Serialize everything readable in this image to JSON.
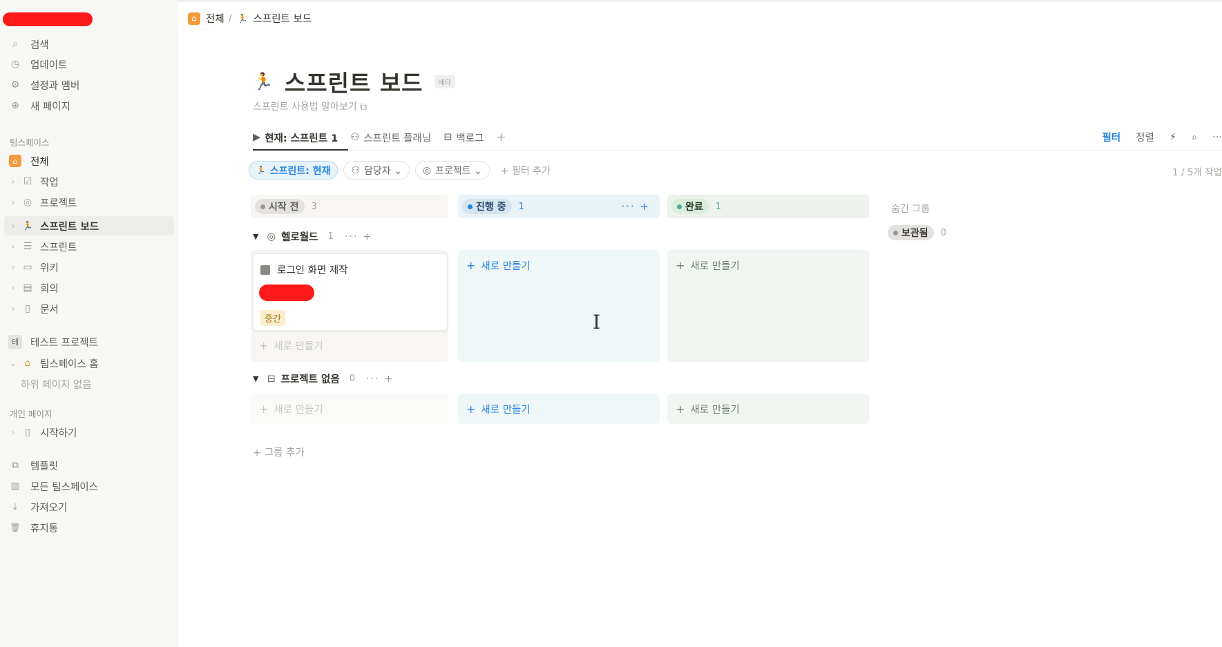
{
  "sidebar": {
    "top_items": [
      {
        "label": "검색",
        "icon": "search-icon",
        "glyph": "⌕"
      },
      {
        "label": "업데이트",
        "icon": "clock-icon",
        "glyph": "◷"
      },
      {
        "label": "설정과 멤버",
        "icon": "gear-icon",
        "glyph": "⚙"
      },
      {
        "label": "새 페이지",
        "icon": "plus-circle-icon",
        "glyph": "⊕"
      }
    ],
    "section_teamspace": "팀스페이스",
    "all_label": "전체",
    "tree_items": [
      {
        "label": "작업",
        "icon": "checkbox-icon",
        "glyph": "☑"
      },
      {
        "label": "프로젝트",
        "icon": "target-icon",
        "glyph": "◎"
      },
      {
        "label": "스프린트 보드",
        "icon": "runner-icon",
        "glyph": "🏃"
      },
      {
        "label": "스프린트",
        "icon": "database-icon",
        "glyph": "☰"
      },
      {
        "label": "위키",
        "icon": "book-icon",
        "glyph": "▭"
      },
      {
        "label": "회의",
        "icon": "calendar-icon",
        "glyph": "▤"
      },
      {
        "label": "문서",
        "icon": "document-icon",
        "glyph": "▯"
      }
    ],
    "test_project": {
      "label": "테스트 프로젝트",
      "badge": "테"
    },
    "teamspace_home": "팀스페이스 홈",
    "no_subpages": "하위 페이지 없음",
    "section_personal": "개인 페이지",
    "getting_started": "시작하기",
    "bottom_items": [
      {
        "label": "템플릿",
        "icon": "template-icon",
        "glyph": "⧉"
      },
      {
        "label": "모든 팀스페이스",
        "icon": "building-icon",
        "glyph": "▥"
      },
      {
        "label": "가져오기",
        "icon": "download-icon",
        "glyph": "⤓"
      },
      {
        "label": "휴지통",
        "icon": "trash-icon",
        "glyph": "🗑"
      }
    ]
  },
  "breadcrumb": {
    "home": "전체",
    "separator": "/",
    "current": "스프린트 보드"
  },
  "page": {
    "title": "스프린트 보드",
    "beta": "베타",
    "subtitle": "스프린트 사용법 알아보기 ⧉"
  },
  "tabs": [
    {
      "label": "현재: 스프린트 1",
      "glyph": "▶",
      "active": true
    },
    {
      "label": "스프린트 플래닝",
      "glyph": "⚇",
      "active": false
    },
    {
      "label": "백로그",
      "glyph": "⊟",
      "active": false
    }
  ],
  "toolbar": {
    "filter": "필터",
    "sort": "정렬",
    "automation": "⚡",
    "search": "⌕",
    "more": "···"
  },
  "filters": {
    "sprint": "스프린트: 현재",
    "assignee": "담당자 ⌄",
    "project": "프로젝트 ⌄",
    "add": "+ 필터 추가"
  },
  "counter": "1 / 5개 작업",
  "columns": [
    {
      "status": "시작 전",
      "count": "3",
      "color": "#9b9a97",
      "bg": "#f7f6f3",
      "pill_bg": "#e3e2e0"
    },
    {
      "status": "진행 중",
      "count": "1",
      "color": "#2383e2",
      "bg": "#e9f3f7",
      "pill_bg": "#d3e5ef"
    },
    {
      "status": "완료",
      "count": "1",
      "color": "#4dab9a",
      "bg": "#edf3ec",
      "pill_bg": "#dbeddb"
    }
  ],
  "column_tools": "··· +",
  "groups": [
    {
      "name": "헬로월드",
      "count": "1"
    },
    {
      "name": "프로젝트 없음",
      "count": "0"
    }
  ],
  "group_tools": "··· +",
  "card": {
    "title": "로그인 화면 제작",
    "priority": "중간"
  },
  "new_label": "새로 만들기",
  "add_group": "+ 그룹 추가",
  "hidden_groups": {
    "title": "숨긴 그룹",
    "archived": "보관됨",
    "count": "0"
  }
}
